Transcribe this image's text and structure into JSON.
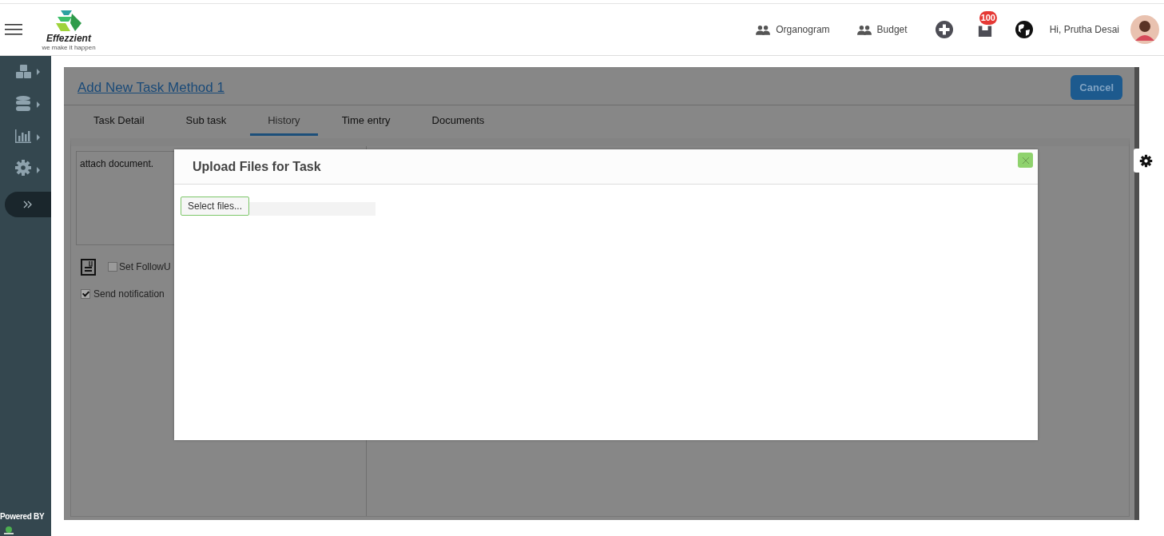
{
  "header": {
    "brand": {
      "name": "Effezzient",
      "tagline": "we make it happen"
    },
    "nav": [
      {
        "label": "Organogram"
      },
      {
        "label": "Budget"
      }
    ],
    "notification_count": "100",
    "greeting": "Hi, Prutha Desai"
  },
  "sidebar": {
    "footer": "Powered BY"
  },
  "task": {
    "title": "Add New Task Method 1",
    "cancel": "Cancel",
    "tabs": [
      {
        "label": "Task Detail",
        "selected": false
      },
      {
        "label": "Sub task",
        "selected": false
      },
      {
        "label": "History",
        "selected": true
      },
      {
        "label": "Time entry",
        "selected": false
      },
      {
        "label": "Documents",
        "selected": false
      }
    ],
    "description": "attach document.",
    "options": [
      {
        "label": "Set FollowU",
        "checked": false
      },
      {
        "label": "Send notification",
        "checked": true
      }
    ]
  },
  "dialog": {
    "title": "Upload Files for Task",
    "button": "Select files..."
  }
}
